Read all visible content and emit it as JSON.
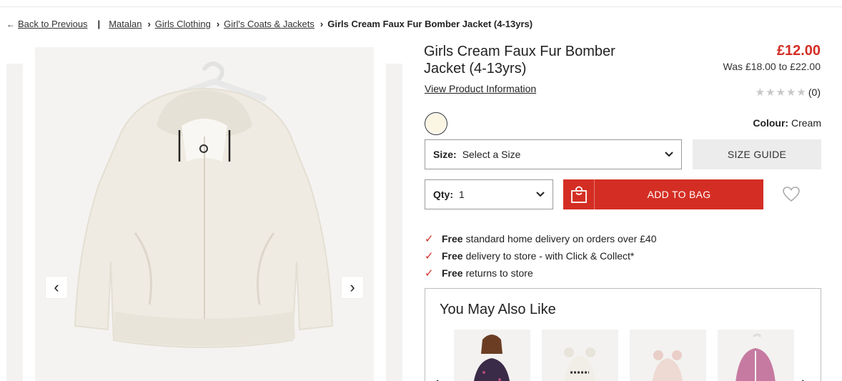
{
  "breadcrumb": {
    "back_label": "Back to Previous",
    "items": [
      "Matalan",
      "Girls Clothing",
      "Girl's Coats & Jackets"
    ],
    "current": "Girls Cream Faux Fur Bomber Jacket (4-13yrs)"
  },
  "gallery": {
    "prev_glyph": "‹",
    "next_glyph": "›"
  },
  "product": {
    "title": "Girls Cream Faux Fur Bomber Jacket (4-13yrs)",
    "price": "£12.00",
    "was_price": "Was £18.00 to £22.00",
    "view_info_label": "View Product Information",
    "rating_stars": "★★★★★",
    "rating_count": "(0)",
    "colour_label": "Colour:",
    "colour_value": "Cream",
    "swatch_color": "#fbf6e4"
  },
  "size": {
    "label": "Size:",
    "value": "Select a Size",
    "guide_label": "SIZE GUIDE"
  },
  "qty": {
    "label": "Qty:",
    "value": "1"
  },
  "add_to_bag": {
    "label": "ADD TO BAG"
  },
  "benefits": [
    {
      "bold": "Free",
      "text": "standard home delivery on orders over £40"
    },
    {
      "bold": "Free",
      "text": "delivery to store - with Click & Collect*"
    },
    {
      "bold": "Free",
      "text": "returns to store"
    }
  ],
  "recommendations": {
    "title": "You May Also Like",
    "prev_glyph": "‹",
    "next_glyph": "›"
  },
  "colors": {
    "accent": "#d42e24",
    "text": "#222222",
    "muted_bg": "#ececec"
  }
}
